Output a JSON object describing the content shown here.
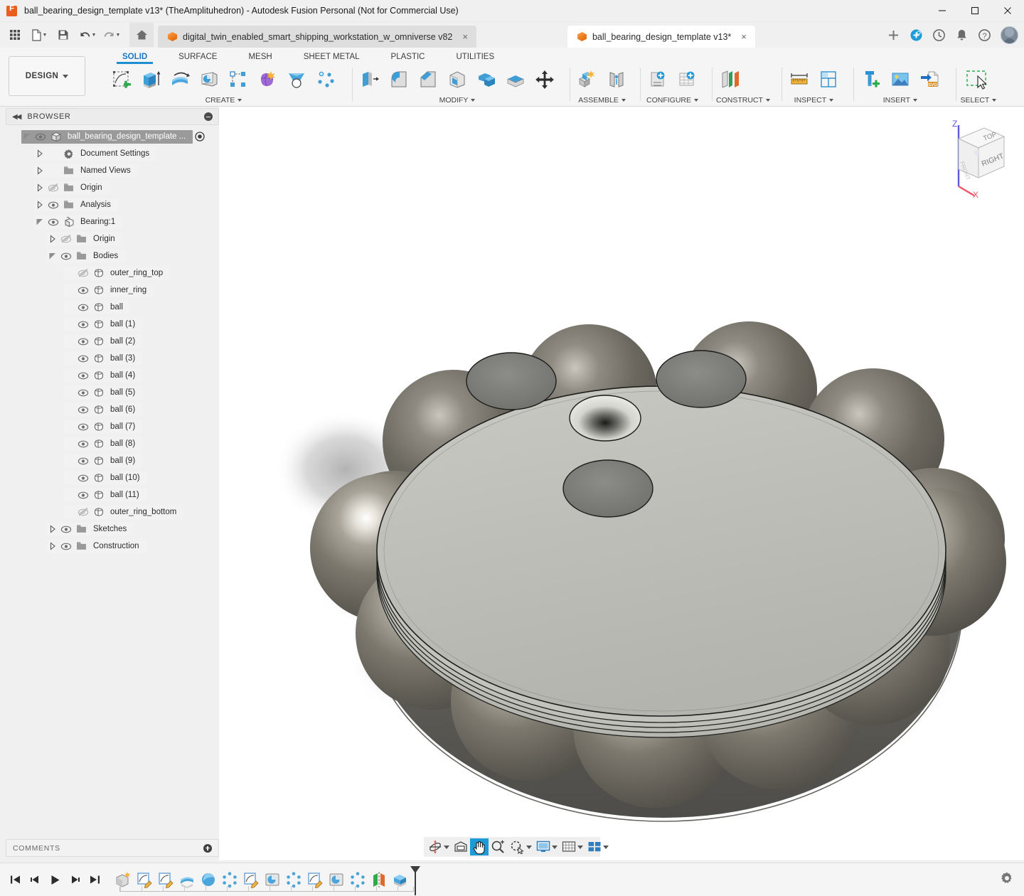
{
  "window": {
    "title": "ball_bearing_design_template v13* (TheAmplituhedron) - Autodesk Fusion Personal (Not for Commercial Use)",
    "logo_color": "#e8601c",
    "minimize_label": "—",
    "maximize_label": "☐",
    "close_label": "✕"
  },
  "quick_access": {
    "items": [
      {
        "name": "app-grid",
        "icon": "grid-icon",
        "label": ""
      },
      {
        "name": "new-file",
        "icon": "file-icon",
        "label": "",
        "caret": true
      },
      {
        "name": "save",
        "icon": "save-icon",
        "label": ""
      },
      {
        "name": "undo",
        "icon": "undo-icon",
        "label": "",
        "caret": true
      },
      {
        "name": "redo",
        "icon": "redo-icon",
        "label": "",
        "caret": true
      },
      {
        "name": "home",
        "icon": "home-icon",
        "label": ""
      }
    ]
  },
  "document_tabs": [
    {
      "label": "digital_twin_enabled_smart_shipping_workstation_w_omniverse v82",
      "active": false,
      "close": "×"
    },
    {
      "label": "ball_bearing_design_template v13*",
      "active": true,
      "close": "×"
    }
  ],
  "tab_actions": [
    {
      "name": "new-tab-button",
      "icon": "plus-icon",
      "label": "+"
    },
    {
      "name": "extensions-button",
      "icon": "extension-icon",
      "label": ""
    },
    {
      "name": "recent-button",
      "icon": "clock-icon",
      "label": ""
    },
    {
      "name": "notifications-button",
      "icon": "bell-icon",
      "label": ""
    },
    {
      "name": "help-button",
      "icon": "question-icon",
      "label": ""
    },
    {
      "name": "account-avatar",
      "icon": "avatar-icon",
      "label": ""
    }
  ],
  "ribbon": {
    "design_button": "DESIGN",
    "tabs": [
      {
        "label": "SOLID",
        "active": true
      },
      {
        "label": "SURFACE",
        "active": false
      },
      {
        "label": "MESH",
        "active": false
      },
      {
        "label": "SHEET METAL",
        "active": false
      },
      {
        "label": "PLASTIC",
        "active": false
      },
      {
        "label": "UTILITIES",
        "active": false
      }
    ],
    "panels": [
      {
        "title": "CREATE",
        "has_caret": true,
        "tools": [
          "create-sketch-icon",
          "extrude-icon",
          "revolve-icon",
          "sweep-icon",
          "rectangular-pattern-icon",
          "form-icon",
          "loft-icon",
          "circular-pattern-icon"
        ]
      },
      {
        "title": "MODIFY",
        "has_caret": true,
        "tools": [
          "press-pull-icon",
          "fillet-icon",
          "chamfer-icon",
          "shell-icon",
          "combine-icon",
          "split-face-icon",
          "move-copy-icon"
        ]
      },
      {
        "title": "ASSEMBLE",
        "has_caret": true,
        "tools": [
          "new-component-icon",
          "joint-icon"
        ]
      },
      {
        "title": "CONFIGURE",
        "has_caret": true,
        "tools": [
          "configure-design-icon",
          "configuration-table-icon"
        ]
      },
      {
        "title": "CONSTRUCT",
        "has_caret": true,
        "tools": [
          "offset-plane-icon"
        ]
      },
      {
        "title": "INSPECT",
        "has_caret": true,
        "tools": [
          "measure-icon",
          "section-analysis-icon"
        ]
      },
      {
        "title": "INSERT",
        "has_caret": true,
        "tools": [
          "insert-mcmaster-icon",
          "insert-image-icon",
          "insert-svg-icon"
        ]
      },
      {
        "title": "SELECT",
        "has_caret": true,
        "tools": [
          "select-window-icon"
        ]
      }
    ]
  },
  "browser": {
    "header": "BROWSER",
    "collapse_icon": "chevron-double-left-icon",
    "minimize_icon": "minus-circle-icon",
    "tree": [
      {
        "label": "ball_bearing_design_template ...",
        "depth": 0,
        "arrow": "expanded",
        "eye": "visible",
        "icon": "document-icon",
        "selected": true,
        "trailing": "radio-dot-icon"
      },
      {
        "label": "Document Settings",
        "depth": 1,
        "arrow": "collapsed",
        "eye": "none",
        "icon": "gear-icon",
        "selected": false
      },
      {
        "label": "Named Views",
        "depth": 1,
        "arrow": "collapsed",
        "eye": "none",
        "icon": "folder-icon",
        "selected": false
      },
      {
        "label": "Origin",
        "depth": 1,
        "arrow": "collapsed",
        "eye": "hidden",
        "icon": "folder-icon",
        "selected": false
      },
      {
        "label": "Analysis",
        "depth": 1,
        "arrow": "collapsed",
        "eye": "visible",
        "icon": "folder-icon",
        "selected": false
      },
      {
        "label": "Bearing:1",
        "depth": 1,
        "arrow": "expanded",
        "eye": "visible",
        "icon": "component-icon",
        "selected": false
      },
      {
        "label": "Origin",
        "depth": 2,
        "arrow": "collapsed",
        "eye": "hidden",
        "icon": "folder-icon",
        "selected": false
      },
      {
        "label": "Bodies",
        "depth": 2,
        "arrow": "expanded",
        "eye": "visible",
        "icon": "folder-icon",
        "selected": false
      },
      {
        "label": "outer_ring_top",
        "depth": 3,
        "arrow": "none",
        "eye": "hidden",
        "icon": "body-icon",
        "selected": false
      },
      {
        "label": "inner_ring",
        "depth": 3,
        "arrow": "none",
        "eye": "visible",
        "icon": "body-icon",
        "selected": false
      },
      {
        "label": "ball",
        "depth": 3,
        "arrow": "none",
        "eye": "visible",
        "icon": "body-icon",
        "selected": false
      },
      {
        "label": "ball (1)",
        "depth": 3,
        "arrow": "none",
        "eye": "visible",
        "icon": "body-icon",
        "selected": false
      },
      {
        "label": "ball (2)",
        "depth": 3,
        "arrow": "none",
        "eye": "visible",
        "icon": "body-icon",
        "selected": false
      },
      {
        "label": "ball (3)",
        "depth": 3,
        "arrow": "none",
        "eye": "visible",
        "icon": "body-icon",
        "selected": false
      },
      {
        "label": "ball (4)",
        "depth": 3,
        "arrow": "none",
        "eye": "visible",
        "icon": "body-icon",
        "selected": false
      },
      {
        "label": "ball (5)",
        "depth": 3,
        "arrow": "none",
        "eye": "visible",
        "icon": "body-icon",
        "selected": false
      },
      {
        "label": "ball (6)",
        "depth": 3,
        "arrow": "none",
        "eye": "visible",
        "icon": "body-icon",
        "selected": false
      },
      {
        "label": "ball (7)",
        "depth": 3,
        "arrow": "none",
        "eye": "visible",
        "icon": "body-icon",
        "selected": false
      },
      {
        "label": "ball (8)",
        "depth": 3,
        "arrow": "none",
        "eye": "visible",
        "icon": "body-icon",
        "selected": false
      },
      {
        "label": "ball (9)",
        "depth": 3,
        "arrow": "none",
        "eye": "visible",
        "icon": "body-icon",
        "selected": false
      },
      {
        "label": "ball (10)",
        "depth": 3,
        "arrow": "none",
        "eye": "visible",
        "icon": "body-icon",
        "selected": false
      },
      {
        "label": "ball (11)",
        "depth": 3,
        "arrow": "none",
        "eye": "visible",
        "icon": "body-icon",
        "selected": false
      },
      {
        "label": "outer_ring_bottom",
        "depth": 3,
        "arrow": "none",
        "eye": "hidden",
        "icon": "body-icon",
        "selected": false
      },
      {
        "label": "Sketches",
        "depth": 2,
        "arrow": "collapsed",
        "eye": "visible",
        "icon": "folder-icon",
        "selected": false
      },
      {
        "label": "Construction",
        "depth": 2,
        "arrow": "collapsed",
        "eye": "visible",
        "icon": "folder-icon",
        "selected": false
      }
    ]
  },
  "comments": {
    "label": "COMMENTS",
    "add_icon": "plus-circle-icon"
  },
  "viewcube": {
    "top_face": "TOP",
    "right_face": "RIGHT",
    "front_face": "FRONT",
    "axis_z": "Z",
    "axis_x": "X",
    "z_color": "#5b5bdc",
    "x_color": "#ee5566"
  },
  "navigation_bar": {
    "items": [
      {
        "name": "orbit-button",
        "icon": "orbit-icon",
        "caret": true,
        "active": false
      },
      {
        "name": "look-at-button",
        "icon": "look-at-icon",
        "caret": false,
        "active": false
      },
      {
        "name": "pan-button",
        "icon": "pan-hand-icon",
        "caret": false,
        "active": true
      },
      {
        "name": "zoom-button",
        "icon": "zoom-icon",
        "caret": false,
        "active": false
      },
      {
        "name": "fit-button",
        "icon": "fit-window-icon",
        "caret": true,
        "active": false
      },
      {
        "name": "display-settings-button",
        "icon": "monitor-icon",
        "caret": true,
        "active": false
      },
      {
        "name": "grid-snap-button",
        "icon": "grid-snap-icon",
        "caret": true,
        "active": false
      },
      {
        "name": "viewports-button",
        "icon": "viewports-icon",
        "caret": true,
        "active": false
      }
    ]
  },
  "timeline": {
    "playback": [
      {
        "name": "timeline-begin-button",
        "icon": "skip-back-icon"
      },
      {
        "name": "timeline-step-back-button",
        "icon": "step-back-icon"
      },
      {
        "name": "timeline-play-button",
        "icon": "play-icon"
      },
      {
        "name": "timeline-step-forward-button",
        "icon": "step-forward-icon"
      },
      {
        "name": "timeline-end-button",
        "icon": "skip-end-icon"
      }
    ],
    "features": [
      "new-component-feature-icon",
      "sketch-feature-icon",
      "sketch-feature-icon",
      "revolve-feature-icon",
      "sphere-feature-icon",
      "circular-pattern-feature-icon",
      "sketch-feature-icon",
      "extrude-feature-icon",
      "circular-pattern-feature-icon",
      "sketch-feature-icon",
      "extrude-feature-icon",
      "circular-pattern-feature-icon",
      "mirror-feature-icon",
      "combine-feature-icon"
    ],
    "marker": "timeline-marker",
    "settings_icon": "gear-icon"
  },
  "model": {
    "description": "ball bearing assembly - inner ring disc with 12 spheres around outer race",
    "ring_color": "#bfbfbb",
    "ball_color": "#6d6a61",
    "recess_color": "#7c7c78",
    "outline_color": "#2a2a2a",
    "ball_count": 12,
    "recess_count": 3,
    "center_hole": true
  }
}
